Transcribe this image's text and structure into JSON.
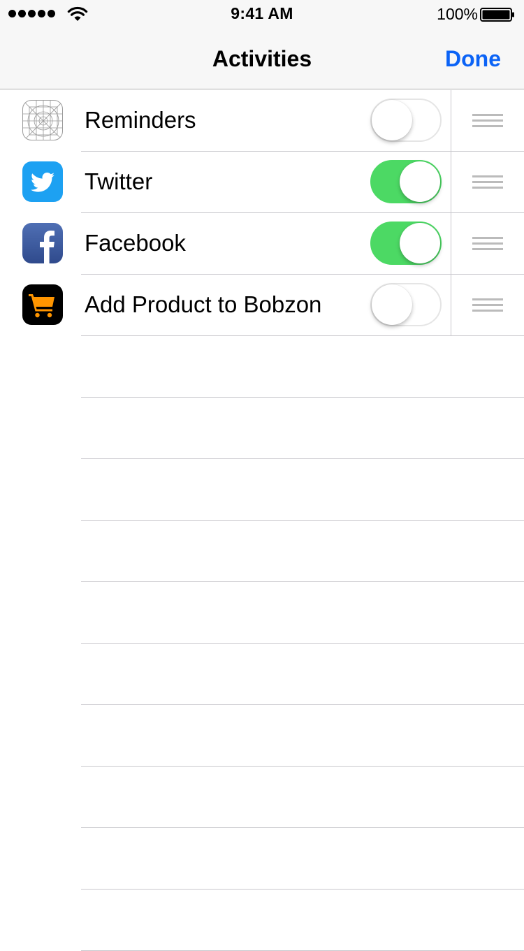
{
  "status_bar": {
    "time": "9:41 AM",
    "battery_percent": "100%",
    "signal_bars": 5
  },
  "nav": {
    "title": "Activities",
    "done_label": "Done",
    "accent_color": "#0b63f6"
  },
  "activities": [
    {
      "label": "Reminders",
      "icon": "reminders-placeholder-icon",
      "enabled": false
    },
    {
      "label": "Twitter",
      "icon": "twitter-icon",
      "enabled": true
    },
    {
      "label": "Facebook",
      "icon": "facebook-icon",
      "enabled": true
    },
    {
      "label": "Add Product to Bobzon",
      "icon": "bobzon-cart-icon",
      "enabled": false
    }
  ],
  "colors": {
    "toggle_on": "#4cd964",
    "twitter_blue": "#1da1f2",
    "facebook_blue": "#3b5998",
    "bobzon_orange": "#ff9500"
  }
}
